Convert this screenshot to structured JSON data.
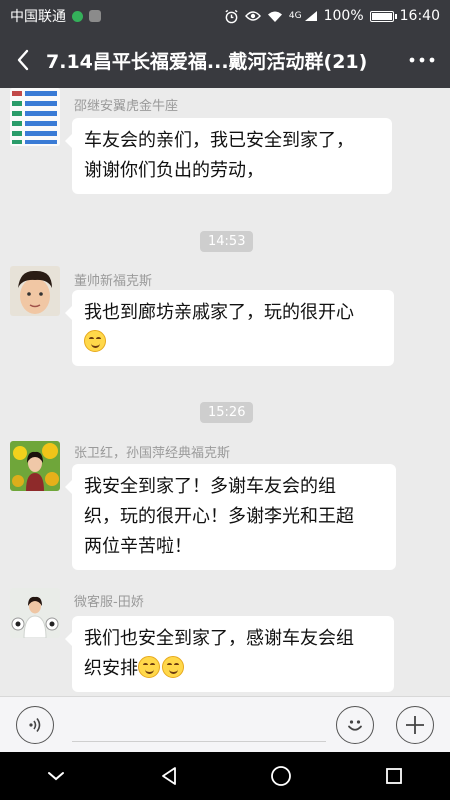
{
  "status_bar": {
    "carrier": "中国联通",
    "network": "4G",
    "battery": "100%",
    "time": "16:40"
  },
  "header": {
    "title": "7.14昌平长福爱福...戴河活动群(21)"
  },
  "messages": [
    {
      "sender": "邵继安翼虎金牛座",
      "lines": [
        "车友会的亲们，我已安全到家了，",
        "谢谢你们负出的劳动，"
      ]
    },
    {
      "time": "14:53"
    },
    {
      "sender": "董帅新福克斯",
      "lines": [
        "我也到廊坊亲戚家了，玩的很开心"
      ]
    },
    {
      "time": "15:26"
    },
    {
      "sender": "张卫红，孙国萍经典福克斯",
      "lines": [
        "我安全到家了！多谢车友会的组",
        "织，玩的很开心！多谢李光和王超",
        "两位辛苦啦！"
      ]
    },
    {
      "sender": "微客服-田娇",
      "lines": [
        "我们也安全到家了，感谢车友会组",
        "织安排"
      ]
    }
  ],
  "colors": {
    "bar_bg": "#393a3f",
    "chat_bg": "#ebebeb",
    "bubble": "#ffffff",
    "emoji": "#ffd84a"
  }
}
